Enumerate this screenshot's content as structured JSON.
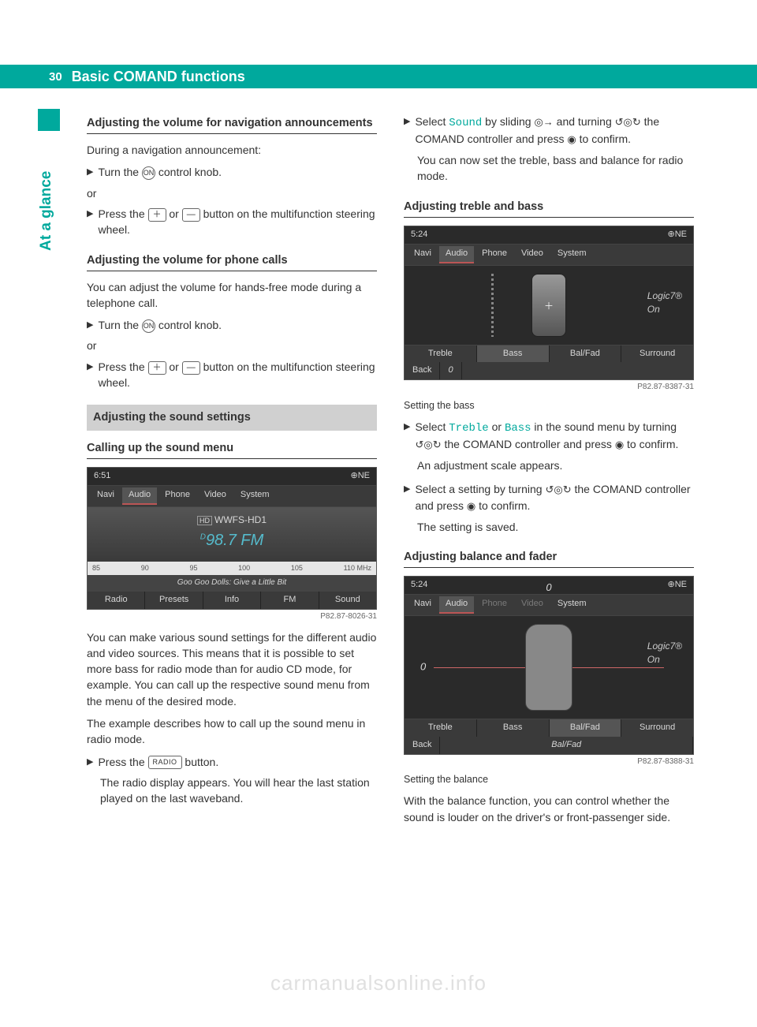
{
  "page_number": "30",
  "header_title": "Basic COMAND functions",
  "side_label": "At a glance",
  "left": {
    "h1": "Adjusting the volume for navigation announcements",
    "p1": "During a navigation announcement:",
    "s1": "Turn the ",
    "s1b": " control knob.",
    "or": "or",
    "s2a": "Press the ",
    "s2b": " or ",
    "s2c": " button on the multifunction steering wheel.",
    "h2": "Adjusting the volume for phone calls",
    "p2": "You can adjust the volume for hands-free mode during a telephone call.",
    "h3_box": "Adjusting the sound settings",
    "h4": "Calling up the sound menu",
    "fig1": {
      "time": "6:51",
      "dir": "⊕NE",
      "menu": [
        "Navi",
        "Audio",
        "Phone",
        "Video",
        "System"
      ],
      "hd": "WWFS-HD1",
      "freq_pre": "D",
      "freq": "98.7 FM",
      "scale": [
        "85",
        "90",
        "95",
        "100",
        "105",
        "110 MHz"
      ],
      "song": "Goo Goo Dolls: Give a Little Bit",
      "bottom": [
        "Radio",
        "Presets",
        "Info",
        "FM",
        "Sound"
      ],
      "id": "P82.87-8026-31"
    },
    "p3": "You can make various sound settings for the different audio and video sources. This means that it is possible to set more bass for radio mode than for audio CD mode, for example. You can call up the respective sound menu from the menu of the desired mode.",
    "p4": "The example describes how to call up the sound menu in radio mode.",
    "s3a": "Press the ",
    "s3_key": "RADIO",
    "s3b": " button.",
    "s3f": "The radio display appears. You will hear the last station played on the last waveband."
  },
  "right": {
    "s1a": "Select ",
    "s1_teal": "Sound",
    "s1b": " by sliding ",
    "s1c": " and turning ",
    "s1d": " the COMAND controller and press ",
    "s1e": " to confirm.",
    "s1f": "You can now set the treble, bass and balance for radio mode.",
    "h1": "Adjusting treble and bass",
    "fig2": {
      "time": "5:24",
      "dir": "⊕NE",
      "menu": [
        "Navi",
        "Audio",
        "Phone",
        "Video",
        "System"
      ],
      "logic": "Logic7®",
      "logic_on": "On",
      "bottom": [
        "Treble",
        "Bass",
        "Bal/Fad",
        "Surround"
      ],
      "back": "Back",
      "val": "0",
      "id": "P82.87-8387-31"
    },
    "cap1": "Setting the bass",
    "s2a": "Select ",
    "s2_t1": "Treble",
    "s2b": " or ",
    "s2_t2": "Bass",
    "s2c": " in the sound menu by turning ",
    "s2d": " the COMAND controller and press ",
    "s2e": " to confirm.",
    "s2f": "An adjustment scale appears.",
    "s3a": "Select a setting by turning ",
    "s3b": " the COMAND controller and press ",
    "s3c": " to confirm.",
    "s3f": "The setting is saved.",
    "h2": "Adjusting balance and fader",
    "fig3": {
      "time": "5:24",
      "top_val": "0",
      "dir": "⊕NE",
      "menu": [
        "Navi",
        "Audio",
        "Phone",
        "Video",
        "System"
      ],
      "left_val": "0",
      "logic": "Logic7®",
      "logic_on": "On",
      "bottom": [
        "Treble",
        "Bass",
        "Bal/Fad",
        "Surround"
      ],
      "back": "Back",
      "back2": "Bal/Fad",
      "id": "P82.87-8388-31"
    },
    "cap2": "Setting the balance",
    "p_last": "With the balance function, you can control whether the sound is louder on the driver's or front-passenger side."
  },
  "keys": {
    "on": "ON",
    "plus": "＋",
    "minus": "—"
  },
  "syms": {
    "slide": "◎→",
    "turn": "↺◎↻",
    "turn2": "↺◎↻",
    "press": "◉"
  },
  "watermark": "carmanualsonline.info"
}
